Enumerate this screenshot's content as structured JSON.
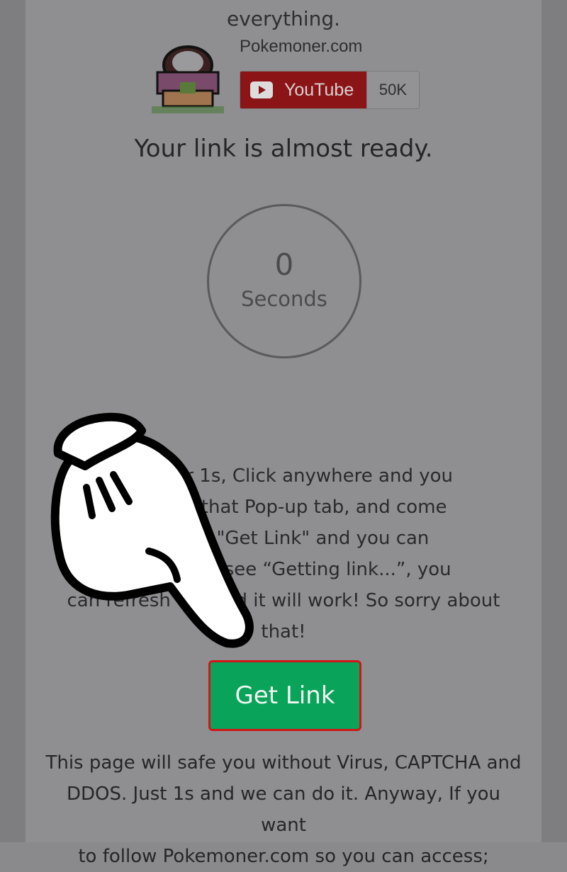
{
  "header": {
    "fragment": "everything."
  },
  "channel": {
    "name": "Pokemoner.com",
    "youtube_label": "YouTube",
    "subscriber_count": "50K"
  },
  "main": {
    "ready_title": "Your link is almost ready.",
    "timer": {
      "value": "0",
      "unit": "Seconds"
    },
    "instructions": {
      "line1": "H                      ing for 1s, Click anywhere and you",
      "line2": "c                       , close that Pop-up tab, and come",
      "line3": "                         ou Click \"Get Link\" and you can",
      "line4": "pa                       k. If you see “Getting link...”, you",
      "line5": "can refresh the           and it will work! So sorry about",
      "line6": "that!"
    },
    "get_link_label": "Get Link",
    "notice": {
      "line1": "This page will safe you without Virus, CAPTCHA and",
      "line2": "DDOS. Just 1s and we can do it. Anyway, If you want",
      "line3": "to follow Pokemoner.com so you can access;"
    }
  },
  "colors": {
    "button_green": "#0aa35a",
    "highlight_red": "#d01618",
    "youtube_red": "#8b1416"
  },
  "icons": {
    "hand": "pointing-hand-icon",
    "play": "youtube-play-icon",
    "avatar": "pokeball-avatar-icon"
  }
}
